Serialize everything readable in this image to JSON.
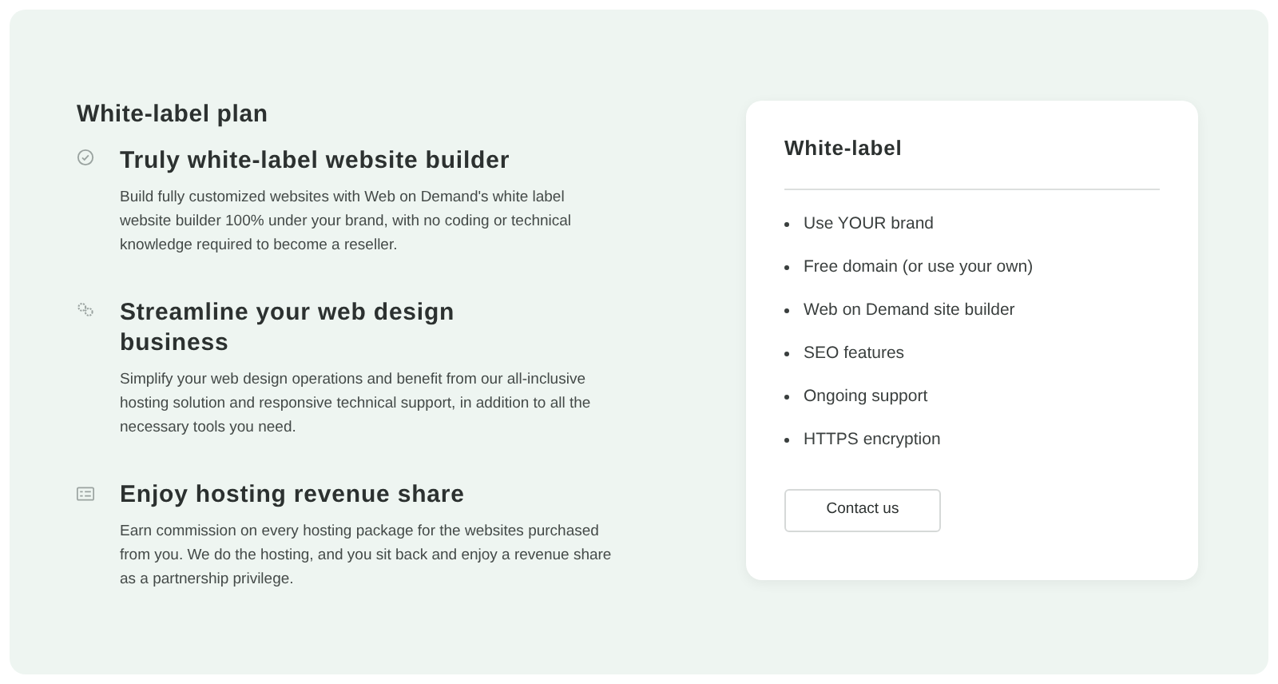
{
  "heading": "White-label plan",
  "features": [
    {
      "kind": "check",
      "title": "Truly white-label website builder",
      "text": "Build fully customized websites with Web on Demand's white label website builder 100% under your brand, with no coding or technical knowledge required to become a reseller."
    },
    {
      "kind": "gears",
      "title": "Streamline your web design business",
      "text": "Simplify your web design operations and benefit from our all-inclusive hosting solution and responsive technical support, in addition to all the necessary tools you need."
    },
    {
      "kind": "card",
      "title": "Enjoy hosting revenue share",
      "text": "Earn commission on every hosting package for the websites purchased from you. We do the hosting, and you sit back and enjoy a revenue share as a partnership privilege."
    }
  ],
  "plan_card": {
    "title": "White-label",
    "items": [
      "Use YOUR brand",
      "Free domain (or use your own)",
      "Web on Demand site builder",
      "SEO features",
      "Ongoing support",
      "HTTPS encryption"
    ],
    "button": "Contact us"
  }
}
